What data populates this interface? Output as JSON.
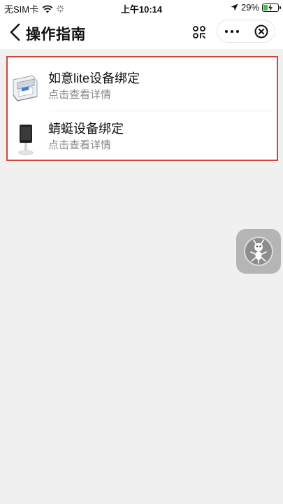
{
  "status_bar": {
    "carrier": "无SIM卡",
    "time": "上午10:14",
    "battery": "29%",
    "battery_level": 0.29
  },
  "nav": {
    "title": "操作指南",
    "back_icon": "chevron-left-icon",
    "scan_icon": "scan-icon",
    "more_icon": "more-dots-icon",
    "close_icon": "close-circle-icon"
  },
  "items": [
    {
      "title": "如意lite设备绑定",
      "subtitle": "点击查看详情",
      "icon": "pos-terminal-image"
    },
    {
      "title": "蜻蜓设备绑定",
      "subtitle": "点击查看详情",
      "icon": "dragonfly-device-image"
    }
  ],
  "colors": {
    "highlight_border": "#d0473a",
    "battery_charging": "#3bc14a",
    "subtitle": "#8a8a8a"
  },
  "float_button": {
    "icon": "ant-mascot-icon"
  }
}
